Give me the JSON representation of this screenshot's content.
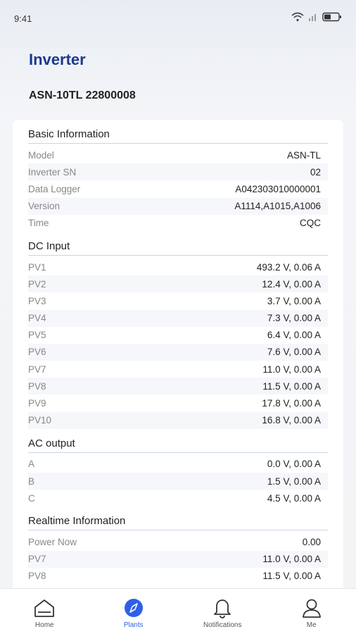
{
  "status_bar": {
    "time": "9:41",
    "icons": [
      "wifi-icon",
      "signal-icon",
      "battery-icon"
    ]
  },
  "header": {
    "title": "Inverter",
    "device_id": "ASN-10TL 22800008"
  },
  "sections": [
    {
      "title": "Basic Information",
      "rows": [
        {
          "label": "Model",
          "value": "ASN-TL"
        },
        {
          "label": "Inverter SN",
          "value": "02"
        },
        {
          "label": "Data Logger",
          "value": "A042303010000001"
        },
        {
          "label": "Version",
          "value": "A1114,A1015,A1006"
        },
        {
          "label": "Time",
          "value": "CQC"
        }
      ]
    },
    {
      "title": "DC Input",
      "rows": [
        {
          "label": "PV1",
          "value": "493.2 V, 0.06 A"
        },
        {
          "label": "PV2",
          "value": "12.4 V, 0.00 A"
        },
        {
          "label": "PV3",
          "value": "3.7 V, 0.00 A"
        },
        {
          "label": "PV4",
          "value": "7.3 V, 0.00 A"
        },
        {
          "label": "PV5",
          "value": "6.4 V, 0.00 A"
        },
        {
          "label": "PV6",
          "value": "7.6 V, 0.00 A"
        },
        {
          "label": "PV7",
          "value": "11.0 V, 0.00 A"
        },
        {
          "label": "PV8",
          "value": "11.5 V, 0.00 A"
        },
        {
          "label": "PV9",
          "value": "17.8 V, 0.00 A"
        },
        {
          "label": "PV10",
          "value": "16.8 V, 0.00 A"
        }
      ]
    },
    {
      "title": "AC output",
      "rows": [
        {
          "label": "A",
          "value": "0.0 V, 0.00 A"
        },
        {
          "label": "B",
          "value": "1.5 V, 0.00 A"
        },
        {
          "label": "C",
          "value": "4.5 V, 0.00 A"
        }
      ]
    },
    {
      "title": "Realtime Information",
      "rows": [
        {
          "label": "Power Now",
          "value": "0.00"
        },
        {
          "label": "PV7",
          "value": "11.0 V, 0.00 A"
        },
        {
          "label": "PV8",
          "value": "11.5 V, 0.00 A"
        }
      ]
    }
  ],
  "tabs": [
    {
      "label": "Home",
      "icon": "home-icon",
      "active": false
    },
    {
      "label": "Plants",
      "icon": "compass-icon",
      "active": true
    },
    {
      "label": "Notifications",
      "icon": "bell-icon",
      "active": false
    },
    {
      "label": "Me",
      "icon": "user-icon",
      "active": false
    }
  ],
  "colors": {
    "accent": "#2f5fe6",
    "title": "#1b3a8f"
  }
}
